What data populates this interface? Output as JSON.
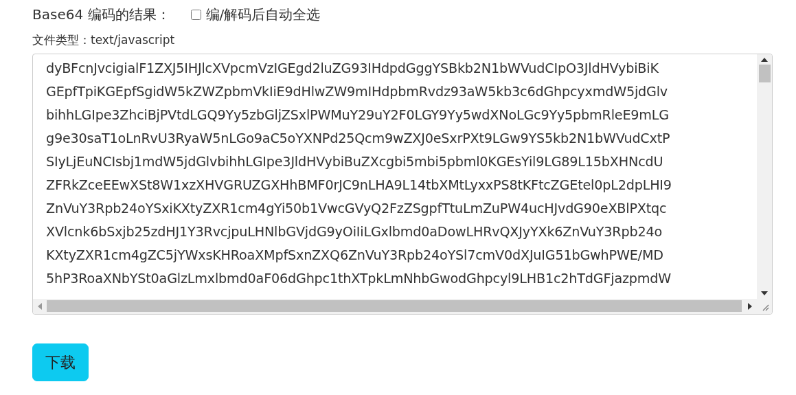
{
  "heading": "Base64 编码的结果：",
  "auto_select": {
    "label": "编/解码后自动全选",
    "checked": false
  },
  "file_type": "文件类型：text/javascript",
  "output": {
    "lines": [
      "dyBFcnJvcigialF1ZXJ5IHJlcXVpcmVzIGEgd2luZG93IHdpdGggYSBkb2N1bWVudCIpO3JldHVybiBiK",
      "GEpfTpiKGEpfSgidW5kZWZpbmVkIiE9dHlwZW9mIHdpbmRvdz93aW5kb3c6dGhpcyxmdW5jdGlv",
      "bihhLGIpe3ZhciBjPVtdLGQ9Yy5zbGljZSxlPWMuY29uY2F0LGY9Yy5wdXNoLGc9Yy5pbmRleE9mLG",
      "g9e30saT1oLnRvU3RyaW5nLGo9aC5oYXNPd25Qcm9wZXJ0eSxrPXt9LGw9YS5kb2N1bWVudCxtP",
      "SIyLjEuNCIsbj1mdW5jdGlvbihhLGIpe3JldHVybiBuZXcgbi5mbi5pbml0KGEsYil9LG89L15bXHNcdU",
      "ZFRkZceEEwXSt8W1xzXHVGRUZGXHhBMF0rJC9nLHA9L14tbXMtLyxxPS8tKFtcZGEtel0pL2dpLHI9",
      "ZnVuY3Rpb24oYSxiKXtyZXR1cm4gYi50b1VwcGVyQ2FzZSgpfTtuLmZuPW4ucHJvdG90eXBlPXtqc",
      "XVlcnk6bSxjb25zdHJ1Y3RvcjpuLHNlbGVjdG9yOiIiLGxlbmd0aDowLHRvQXJyYXk6ZnVuY3Rpb24o",
      "KXtyZXR1cm4gZC5jYWxsKHRoaXMpfSxnZXQ6ZnVuY3Rpb24oYSl7cmV0dXJuIG51bGwhPWE/MD",
      "5hP3RoaXNbYSt0aGlzLmxlbmd0aF06dGhpc1thXTpkLmNhbGwodGhpcyl9LHB1c2hTdGFjazpmdW"
    ]
  },
  "download_button": "下载"
}
